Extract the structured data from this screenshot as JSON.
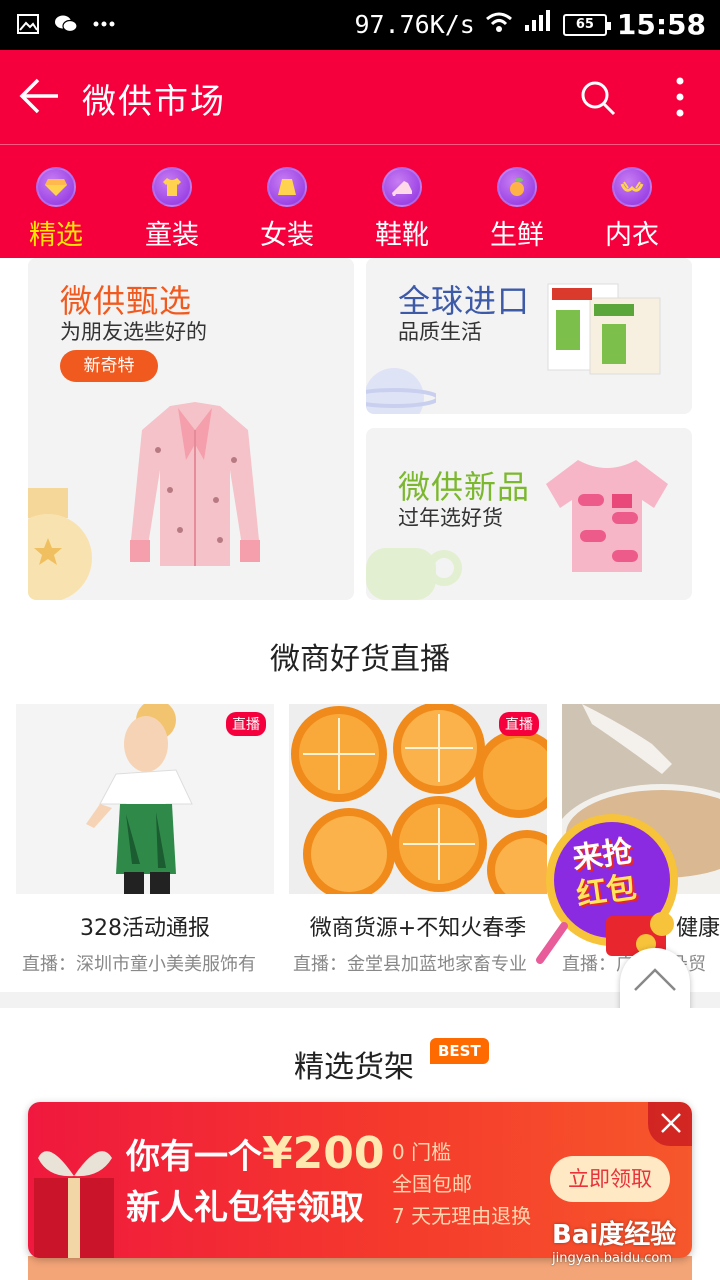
{
  "status_bar": {
    "speed": "97.76K/s",
    "battery": "65",
    "time": "15:58"
  },
  "header": {
    "title": "微供市场"
  },
  "categories": [
    {
      "label": "精选",
      "icon": "gem-icon",
      "active": true
    },
    {
      "label": "童装",
      "icon": "kids-shirt-icon",
      "active": false
    },
    {
      "label": "女装",
      "icon": "skirt-icon",
      "active": false
    },
    {
      "label": "鞋靴",
      "icon": "high-heel-icon",
      "active": false
    },
    {
      "label": "生鲜",
      "icon": "peach-icon",
      "active": false
    },
    {
      "label": "内衣",
      "icon": "bra-icon",
      "active": false
    }
  ],
  "promos": {
    "big": {
      "title": "微供甄选",
      "subtitle": "为朋友选些好的",
      "badge": "新奇特",
      "title_color": "#f15a1f"
    },
    "top_right": {
      "title": "全球进口",
      "subtitle": "品质生活",
      "title_color": "#3d5aa8"
    },
    "bottom_right": {
      "title": "微供新品",
      "subtitle": "过年选好货",
      "title_color": "#7cb82f"
    }
  },
  "live_section": {
    "title": "微商好货直播",
    "badge": "直播",
    "items": [
      {
        "title": "328活动通报",
        "subtitle": "直播：深圳市童小美美服饰有"
      },
      {
        "title": "微商货源+不知火春季",
        "subtitle": "直播：金堂县加蓝地家畜专业"
      },
      {
        "title": "健康",
        "subtitle": "直播：广州医朵贸"
      }
    ]
  },
  "red_packet": {
    "line1": "来抢",
    "line2": "红包"
  },
  "back_to_top": {
    "label": "顶部"
  },
  "shelf": {
    "title": "精选货架",
    "tag": "BEST"
  },
  "gift_banner": {
    "line1_prefix": "你有一个",
    "amount": "¥200",
    "line2": "新人礼包待领取",
    "features": [
      "0 门槛",
      "全国包邮",
      "7 天无理由退换"
    ],
    "button": "立即领取"
  },
  "watermark": {
    "logo": "Bai度经验",
    "url": "jingyan.baidu.com"
  },
  "colors": {
    "brand": "#f5003d",
    "active_tab": "#ffe600",
    "badge_orange": "#f15a1f"
  }
}
